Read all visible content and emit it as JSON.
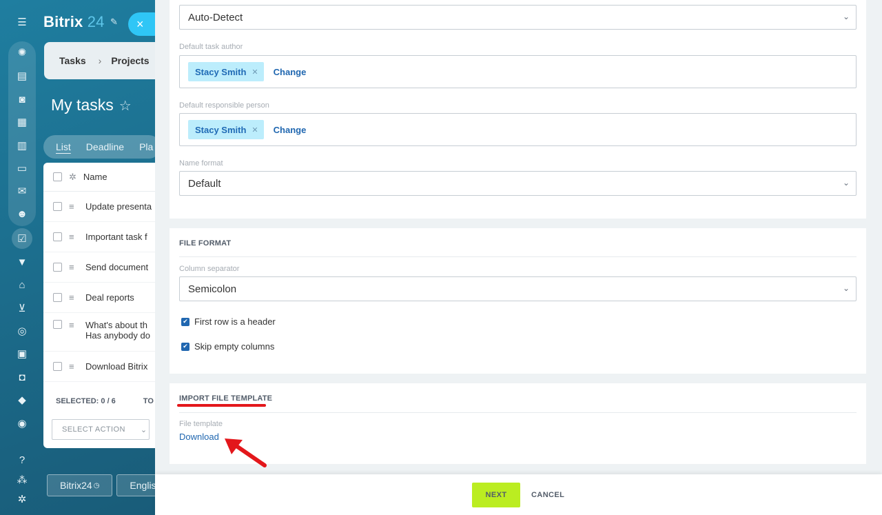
{
  "app": {
    "brand": "Bitrix",
    "brand_num": "24",
    "close_icon": "×"
  },
  "breadcrumbs": [
    "Tasks",
    "Projects"
  ],
  "page_title": "My tasks",
  "view_tabs": [
    "List",
    "Deadline",
    "Pla"
  ],
  "grid": {
    "header_name": "Name",
    "rows": [
      "Update presenta",
      "Important task f",
      "Send document",
      "Deal reports",
      "What's about th",
      "Download Bitrix"
    ],
    "row5_line2": "Has anybody do",
    "selected_label": "SELECTED: 0 / 6",
    "total_label": "TO",
    "select_action": "SELECT ACTION"
  },
  "bottom_bar": {
    "bitrix_btn": "Bitrix24",
    "lang_btn": "Englis"
  },
  "form": {
    "encoding_value": "Auto-Detect",
    "author_label": "Default task author",
    "author_name": "Stacy Smith",
    "responsible_label": "Default responsible person",
    "responsible_name": "Stacy Smith",
    "change_label": "Change",
    "name_format_label": "Name format",
    "name_format_value": "Default",
    "file_format_title": "FILE FORMAT",
    "separator_label": "Column separator",
    "separator_value": "Semicolon",
    "first_row_header": "First row is a header",
    "skip_empty": "Skip empty columns",
    "template_title": "IMPORT FILE TEMPLATE",
    "template_label": "File template",
    "download_link": "Download"
  },
  "footer": {
    "next": "NEXT",
    "cancel": "CANCEL"
  },
  "colors": {
    "accent_green": "#bbed21",
    "link_blue": "#2067b0",
    "annotation_red": "#e3171b"
  }
}
